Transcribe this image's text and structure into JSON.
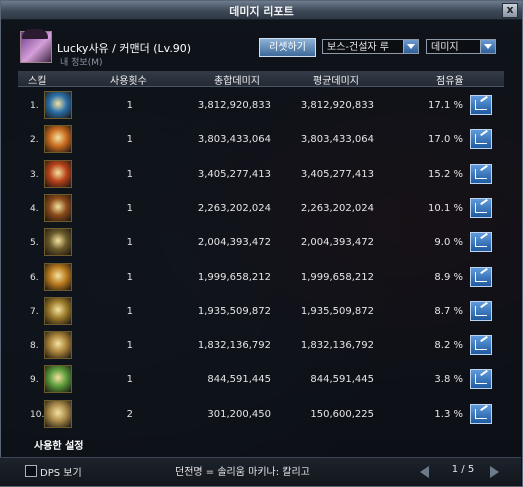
{
  "window": {
    "title": "데미지 리포트",
    "close": "x"
  },
  "character": {
    "name": "Lucky사유 / 커맨더 (Lv.90)",
    "sub": "내 정보(M)"
  },
  "controls": {
    "reset_label": "리셋하기",
    "boss_select": "보스-건설자 루",
    "type_select": "데미지"
  },
  "columns": {
    "skill": "스킬",
    "uses": "사용횟수",
    "total": "총합데미지",
    "avg": "평균데미지",
    "share": "점유율"
  },
  "rows": [
    {
      "rank": "1.",
      "uses": "1",
      "total": "3,812,920,833",
      "avg": "3,812,920,833",
      "share": "17.1 %",
      "icon": "skill-icon-blue-orbs",
      "color": "#2a6fa8"
    },
    {
      "rank": "2.",
      "uses": "1",
      "total": "3,803,433,064",
      "avg": "3,803,433,064",
      "share": "17.0 %",
      "icon": "skill-icon-fire-burst",
      "color": "#c86a1e"
    },
    {
      "rank": "3.",
      "uses": "1",
      "total": "3,405,277,413",
      "avg": "3,405,277,413",
      "share": "15.2 %",
      "icon": "skill-icon-red-swirl",
      "color": "#b8431a"
    },
    {
      "rank": "4.",
      "uses": "1",
      "total": "2,263,202,024",
      "avg": "2,263,202,024",
      "share": "10.1 %",
      "icon": "skill-icon-scythe",
      "color": "#8a4a1a"
    },
    {
      "rank": "5.",
      "uses": "1",
      "total": "2,004,393,472",
      "avg": "2,004,393,472",
      "share": "9.0 %",
      "icon": "skill-icon-shot",
      "color": "#6a5a2a"
    },
    {
      "rank": "6.",
      "uses": "1",
      "total": "1,999,658,212",
      "avg": "1,999,658,212",
      "share": "8.9 %",
      "icon": "skill-icon-flame-ring",
      "color": "#b87a1e"
    },
    {
      "rank": "7.",
      "uses": "1",
      "total": "1,935,509,872",
      "avg": "1,935,509,872",
      "share": "8.7 %",
      "icon": "skill-icon-spark",
      "color": "#9a7a2a"
    },
    {
      "rank": "8.",
      "uses": "1",
      "total": "1,832,136,792",
      "avg": "1,832,136,792",
      "share": "8.2 %",
      "icon": "skill-icon-bomb",
      "color": "#a8823a"
    },
    {
      "rank": "9.",
      "uses": "1",
      "total": "844,591,445",
      "avg": "844,591,445",
      "share": "3.8 %",
      "icon": "skill-icon-green-blast",
      "color": "#5a9a3a"
    },
    {
      "rank": "10.",
      "uses": "2",
      "total": "301,200,450",
      "avg": "150,600,225",
      "share": "1.3 %",
      "icon": "skill-icon-cannon",
      "color": "#a88a4a"
    }
  ],
  "footer": {
    "used_settings": "사용한 설정",
    "dps_label": "DPS 보기",
    "dungeon": "던전명 = 솔리움 마키나: 칼리고",
    "page": "1 / 5"
  }
}
